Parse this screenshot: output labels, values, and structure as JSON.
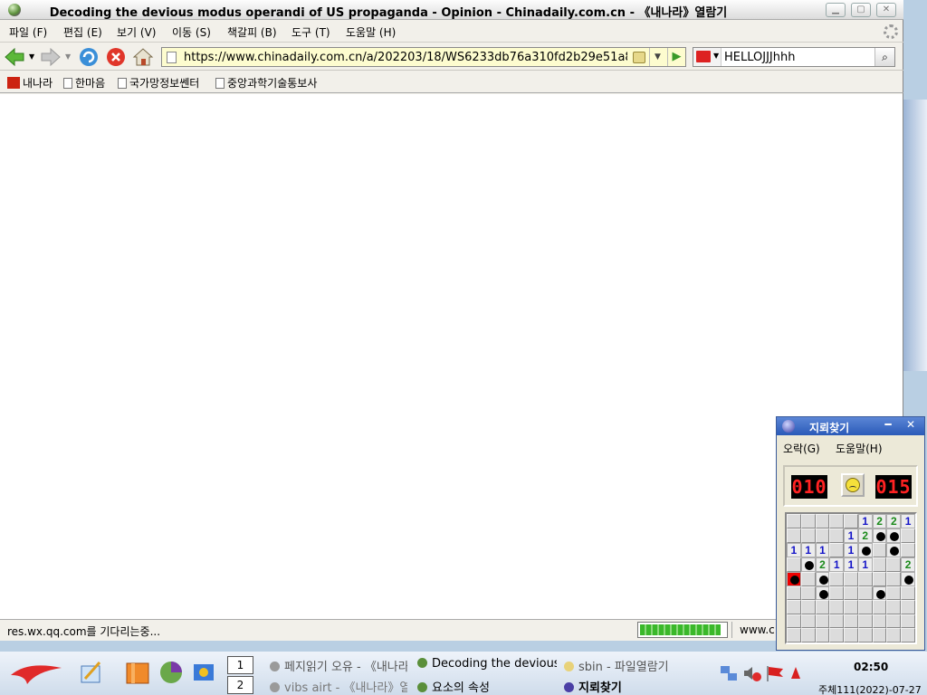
{
  "browser": {
    "title": "Decoding the devious modus operandi of US propaganda - Opinion - Chinadaily.com.cn - 《내나라》열람기",
    "menu": [
      "파일 (F)",
      "편집 (E)",
      "보기 (V)",
      "이동 (S)",
      "책갈피 (B)",
      "도구 (T)",
      "도움말 (H)"
    ],
    "url": "https://www.chinadaily.com.cn/a/202203/18/WS6233db76a310fd2b29e51a8",
    "search_text": "HELLOJJJhhh",
    "bookmarks": [
      "내나라",
      "한마음",
      "국가망정보쎈터",
      "중앙과학기술통보사"
    ],
    "status_text": "res.wx.qq.com를 기다리는중...",
    "status_url": "www.c",
    "progress_fraction": 0.95
  },
  "minesweeper": {
    "title": "지뢰찾기",
    "menu": [
      "오락(G)",
      "도움말(H)"
    ],
    "mines_left": "010",
    "timer": "015",
    "board": [
      "c",
      "c",
      "c",
      "c",
      "c",
      "1",
      "2",
      "2",
      "1",
      "c",
      "c",
      "c",
      "c",
      "1",
      "2",
      "m",
      "m",
      "c",
      "1",
      "1",
      "1",
      "c",
      "1",
      "m",
      "c",
      "m",
      "c",
      "c",
      "m",
      "2",
      "1",
      "1",
      "1",
      "c",
      "c",
      "2",
      "x",
      "c",
      "m",
      "c",
      "c",
      "c",
      "c",
      "c",
      "m",
      "c",
      "c",
      "m",
      "c",
      "c",
      "c",
      "m",
      "c",
      "c",
      "c",
      "c",
      "c",
      "c",
      "c",
      "c",
      "c",
      "c",
      "c",
      "c",
      "c",
      "c",
      "c",
      "c",
      "c",
      "c",
      "c",
      "c",
      "c",
      "c",
      "c",
      "c",
      "c",
      "c",
      "c",
      "c",
      "c"
    ]
  },
  "taskbar": {
    "workspaces": [
      "1",
      "2"
    ],
    "tasks": [
      {
        "label": "페지읽기 오유 - 《내나라》",
        "color": "#9a9a9a"
      },
      {
        "label": "Decoding the devious",
        "color": "#5a8f3a"
      },
      {
        "label": "sbin - 파일열람기",
        "color": "#e8d27a"
      },
      {
        "label": "vibs airt - 《내나라》열",
        "color": "#9a9a9a"
      },
      {
        "label": "요소의 속성",
        "color": "#5a8f3a"
      },
      {
        "label": "지뢰찾기",
        "color": "#4a3fa5"
      }
    ],
    "clock": "02:50",
    "date": "주체111(2022)-07-27"
  }
}
